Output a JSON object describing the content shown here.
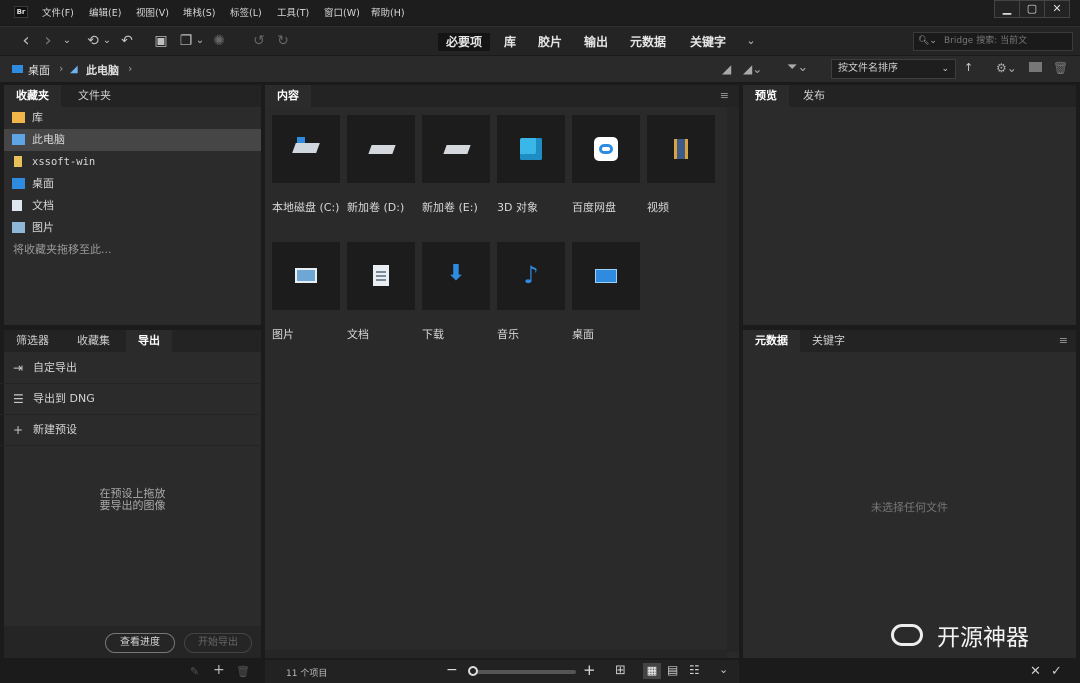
{
  "menubar": {
    "logo": "Br",
    "items": [
      "文件(F)",
      "编辑(E)",
      "视图(V)",
      "堆栈(S)",
      "标签(L)",
      "工具(T)",
      "窗口(W)",
      "帮助(H)"
    ],
    "window_buttons": [
      "▁",
      "▢",
      "✕"
    ]
  },
  "toolbar": {
    "workspaces": [
      "必要项",
      "库",
      "胶片",
      "输出",
      "元数据",
      "关键字"
    ],
    "active_workspace": "必要项",
    "search_placeholder": "Bridge 搜索: 当前文"
  },
  "pathbar": {
    "crumbs": [
      "桌面",
      "此电脑"
    ],
    "sort_label": "按文件名排序"
  },
  "left_top": {
    "tabs": [
      "收藏夹",
      "文件夹"
    ],
    "favorites": [
      "库",
      "此电脑",
      "xssoft-win",
      "桌面",
      "文档",
      "图片"
    ],
    "hint": "将收藏夹拖移至此..."
  },
  "left_bottom": {
    "tabs": [
      "筛选器",
      "收藏集",
      "导出"
    ],
    "rows": [
      "自定导出",
      "导出到 DNG",
      "新建预设"
    ],
    "drop_hint_1": "在预设上拖放",
    "drop_hint_2": "要导出的图像",
    "progress_button": "查看进度",
    "start_button": "开始导出"
  },
  "content": {
    "tab": "内容",
    "items": [
      {
        "label": "本地磁盘 (C:)",
        "icon": "windows-drive-icon"
      },
      {
        "label": "新加卷 (D:)",
        "icon": "drive-icon"
      },
      {
        "label": "新加卷 (E:)",
        "icon": "drive-icon"
      },
      {
        "label": "3D 对象",
        "icon": "3d-objects-icon"
      },
      {
        "label": "百度网盘",
        "icon": "baidu-netdisk-icon"
      },
      {
        "label": "视频",
        "icon": "video-folder-icon"
      },
      {
        "label": "图片",
        "icon": "pictures-folder-icon"
      },
      {
        "label": "文档",
        "icon": "documents-folder-icon"
      },
      {
        "label": "下载",
        "icon": "downloads-folder-icon"
      },
      {
        "label": "音乐",
        "icon": "music-folder-icon"
      },
      {
        "label": "桌面",
        "icon": "desktop-folder-icon"
      }
    ],
    "status": "11 个项目"
  },
  "right_top": {
    "tabs": [
      "预览",
      "发布"
    ]
  },
  "right_bottom": {
    "tabs": [
      "元数据",
      "关键字"
    ],
    "empty_text": "未选择任何文件"
  },
  "watermark": {
    "text": "开源神器"
  },
  "colors": {
    "accent_blue": "#2e8be0",
    "panel_bg": "#2b2b2b",
    "app_bg": "#1b1b1b"
  }
}
